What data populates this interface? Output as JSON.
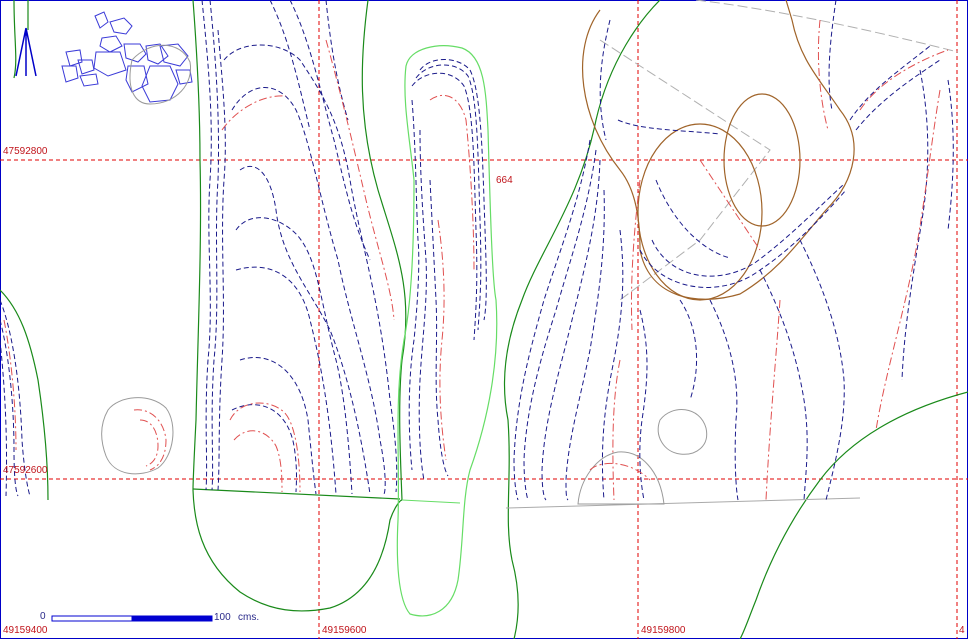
{
  "grid": {
    "northing_labels": [
      "47592800",
      "47592600"
    ],
    "easting_labels": [
      "49159400",
      "49159600",
      "49159800",
      "4"
    ],
    "grid_color": "#e00000"
  },
  "annotations": {
    "elevation_label": "664"
  },
  "scale_bar": {
    "start_label": "0",
    "end_label": "100",
    "unit_label": "cms.",
    "color": "#0000d0"
  },
  "north_arrow": {
    "icon": "north-arrow-icon",
    "color": "#0000c8"
  },
  "colors": {
    "contour_dark": "#1a1a8a",
    "contour_red": "#e05050",
    "boundary_green": "#1a8a1a",
    "boundary_light_green": "#66dd66",
    "trench_brown": "#a0642a",
    "stone_blue": "#3a3ad8",
    "outline_gray": "#9a9a9a",
    "frame_blue": "#0000c8"
  }
}
